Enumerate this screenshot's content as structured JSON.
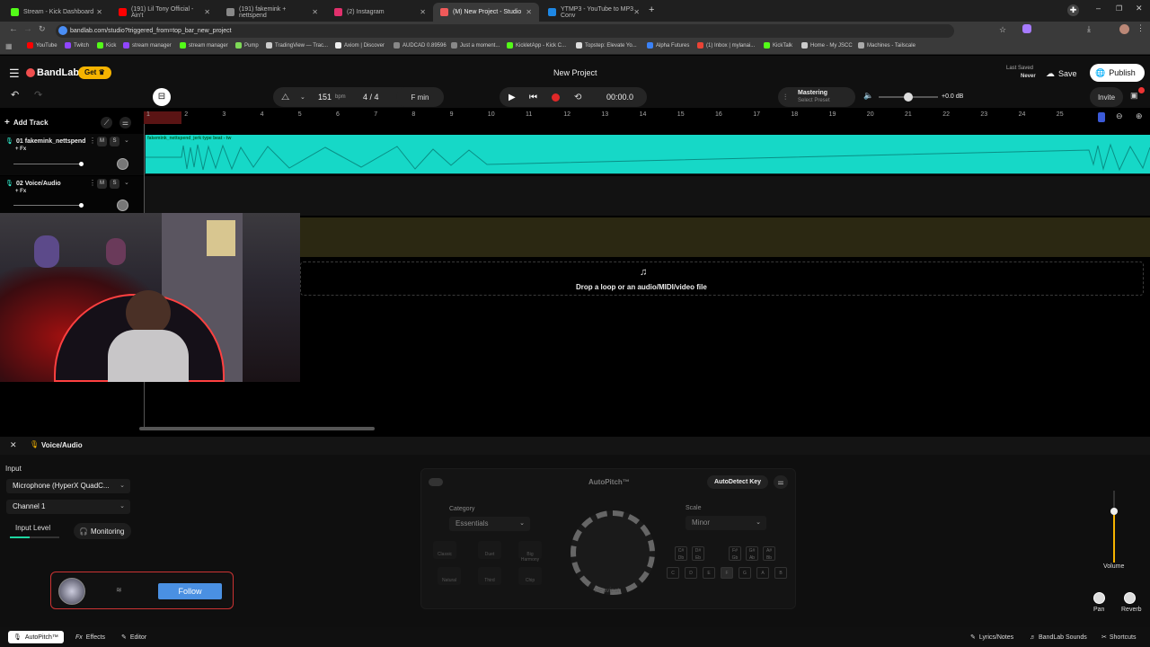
{
  "browser": {
    "tabs": [
      {
        "title": "Stream - Kick Dashboard",
        "color": "#53fc18"
      },
      {
        "title": "(191) Lil Tony Official - Ain't",
        "color": "#ff0000"
      },
      {
        "title": "(191) fakemink + nettspend",
        "color": "#888888"
      },
      {
        "title": "(2) Instagram",
        "color": "#e1306c"
      },
      {
        "title": "(M) New Project - Studio",
        "color": "#f05a5a"
      },
      {
        "title": "YTMP3 - YouTube to MP3 Conv",
        "color": "#1e88e5"
      }
    ],
    "url": "bandlab.com/studio?triggered_from=top_bar_new_project",
    "bookmarks": [
      "YouTube",
      "Twitch",
      "Kick",
      "stream manager",
      "stream manager",
      "Pump",
      "TradingView — Trac...",
      "Axiom | Discover",
      "AUDCAD 0.89596",
      "Just a moment...",
      "KickletApp - Kick C...",
      "Topstep: Elevate Yo...",
      "Alpha Futures",
      "(1) Inbox | mylanai...",
      "KickTalk",
      "Home - My JSCC",
      "Machines - Tailscale"
    ]
  },
  "app": {
    "logo": "BandLab",
    "get_label": "Get",
    "project_title": "New Project",
    "last_saved_label": "Last Saved",
    "last_saved_value": "Never",
    "save_label": "Save",
    "publish_label": "Publish",
    "invite_label": "Invite"
  },
  "toolbar": {
    "bpm": "151",
    "bpm_unit": "bpm",
    "time_sig": "4 / 4",
    "key": "F min",
    "time": "00:00.0",
    "mastering_label": "Mastering",
    "mastering_sub": "Select Preset",
    "volume_db": "+0.0 dB",
    "volume_level": 0.5
  },
  "timeline": {
    "add_track_label": "Add Track",
    "ruler": [
      "1",
      "2",
      "3",
      "4",
      "5",
      "6",
      "7",
      "8",
      "9",
      "10",
      "11",
      "12",
      "13",
      "14",
      "15",
      "16",
      "17",
      "18",
      "19",
      "20",
      "21",
      "22",
      "23",
      "24",
      "25"
    ],
    "tracks": [
      {
        "num": "01",
        "name": "fakemink_nettspend",
        "fx": "+ Fx",
        "m": "M",
        "s": "S"
      },
      {
        "num": "02",
        "name": "Voice/Audio",
        "fx": "+ Fx",
        "m": "M",
        "s": "S"
      }
    ],
    "clip_label": "fakemink_nettspend_jerk type beat - tw",
    "drop_text": "Drop a loop or an audio/MIDI/video file"
  },
  "panel": {
    "title": "Voice/Audio",
    "input_label": "Input",
    "input_device": "Microphone (HyperX QuadC...",
    "channel": "Channel 1",
    "input_level_label": "Input Level",
    "monitoring_label": "Monitoring",
    "autopitch": {
      "title": "AutoPitch™",
      "autodetect_label": "AutoDetect Key",
      "category_label": "Category",
      "category_value": "Essentials",
      "scale_label": "Scale",
      "scale_value": "Minor",
      "knob_label": "Heaviest",
      "presets": [
        "Classic",
        "Duet",
        "Big Harmony",
        "Natural",
        "Third",
        "Chip"
      ],
      "sharps": [
        "C# Db",
        "D# Eb",
        "F# Gb",
        "G# Ab",
        "A# Bb"
      ],
      "keys": [
        "C",
        "D",
        "E",
        "F",
        "G",
        "A",
        "B"
      ]
    },
    "volume_label": "Volume",
    "pan_label": "Pan",
    "reverb_label": "Reverb"
  },
  "follow": {
    "label": "Follow"
  },
  "bottombar": {
    "autopitch": "AutoPitch™",
    "effects": "Effects",
    "editor": "Editor",
    "lyrics": "Lyrics/Notes",
    "sounds": "BandLab Sounds",
    "shortcuts": "Shortcuts"
  }
}
